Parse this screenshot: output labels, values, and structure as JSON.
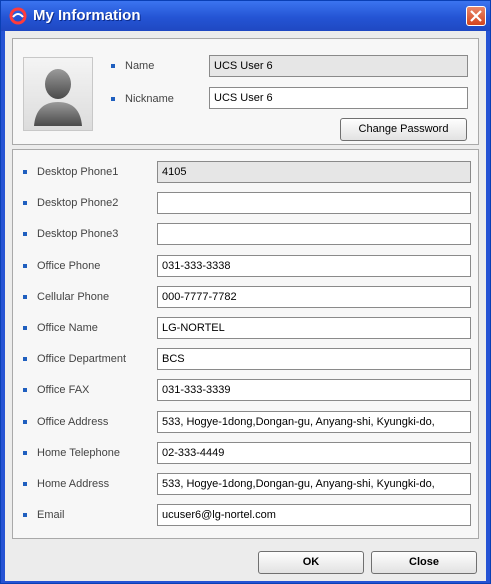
{
  "window": {
    "title": "My Information"
  },
  "profile": {
    "name_label": "Name",
    "name_value": "UCS User 6",
    "nickname_label": "Nickname",
    "nickname_value": "UCS User 6",
    "change_password_label": "Change Password"
  },
  "fields": [
    {
      "label": "Desktop Phone1",
      "value": "4105",
      "readonly": true
    },
    {
      "label": "Desktop Phone2",
      "value": "",
      "readonly": false
    },
    {
      "label": "Desktop Phone3",
      "value": "",
      "readonly": false
    },
    {
      "label": "Office Phone",
      "value": "031-333-3338",
      "readonly": false
    },
    {
      "label": "Cellular Phone",
      "value": "000-7777-7782",
      "readonly": false
    },
    {
      "label": "Office Name",
      "value": "LG-NORTEL",
      "readonly": false
    },
    {
      "label": "Office Department",
      "value": "BCS",
      "readonly": false
    },
    {
      "label": "Office FAX",
      "value": "031-333-3339",
      "readonly": false
    },
    {
      "label": "Office Address",
      "value": "533, Hogye-1dong,Dongan-gu, Anyang-shi, Kyungki-do,",
      "readonly": false
    },
    {
      "label": "Home Telephone",
      "value": "02-333-4449",
      "readonly": false
    },
    {
      "label": "Home Address",
      "value": "533, Hogye-1dong,Dongan-gu, Anyang-shi, Kyungki-do,",
      "readonly": false
    },
    {
      "label": "Email",
      "value": "ucuser6@lg-nortel.com",
      "readonly": false
    }
  ],
  "footer": {
    "ok_label": "OK",
    "close_label": "Close"
  },
  "icons": {
    "title": "app-swirl-icon",
    "close": "close-x-icon",
    "avatar": "user-silhouette-icon"
  },
  "colors": {
    "titlebar": "#2454d4",
    "bullet": "#1f5fbf",
    "close": "#d4441e"
  }
}
